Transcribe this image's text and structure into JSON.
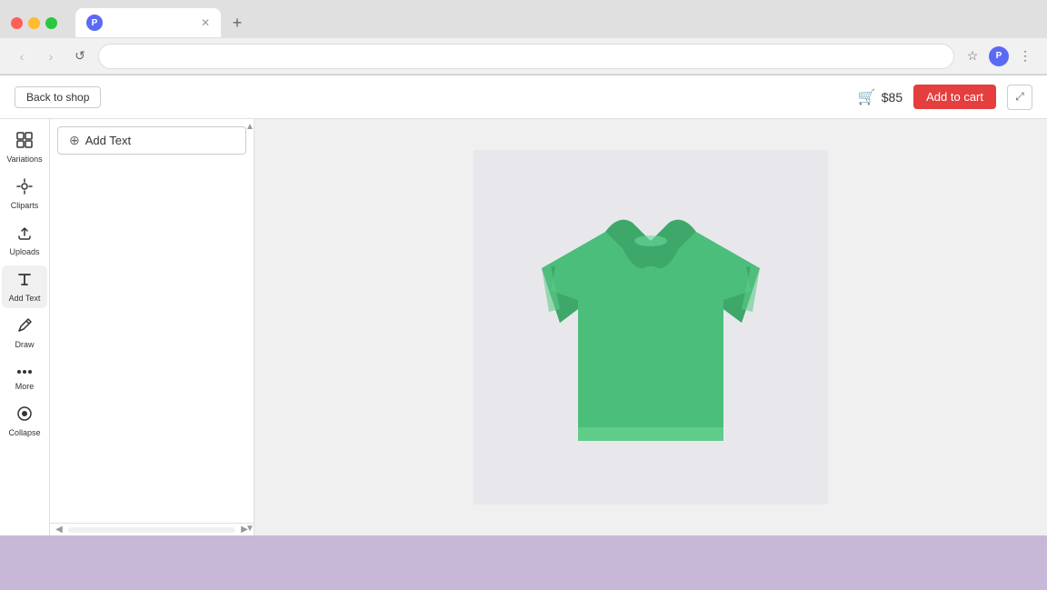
{
  "browser": {
    "tab_title": "",
    "tab_favicon": "P",
    "address": "",
    "back_disabled": true,
    "forward_disabled": true
  },
  "toolbar": {
    "back_label": "Back to shop",
    "price": "$85",
    "add_to_cart_label": "Add to cart"
  },
  "sidebar": {
    "items": [
      {
        "id": "variations",
        "icon": "⊞",
        "label": "Variations"
      },
      {
        "id": "cliparts",
        "icon": "✿",
        "label": "Cliparts"
      },
      {
        "id": "uploads",
        "icon": "⬆",
        "label": "Uploads"
      },
      {
        "id": "add-text",
        "icon": "¶",
        "label": "Add Text",
        "active": true
      },
      {
        "id": "draw",
        "icon": "✏",
        "label": "Draw"
      },
      {
        "id": "more",
        "icon": "•••",
        "label": "More"
      },
      {
        "id": "collapse",
        "icon": "◉",
        "label": "Collapse"
      }
    ]
  },
  "panel": {
    "add_text_label": "Add Text",
    "add_text_icon": "+"
  }
}
